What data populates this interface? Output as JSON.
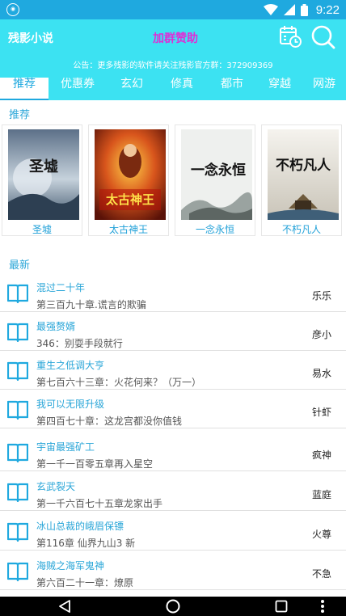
{
  "status_bar": {
    "time": "9:22",
    "icons": [
      "notification-icon",
      "wifi-icon",
      "signal-icon",
      "battery-icon"
    ]
  },
  "header": {
    "app_title": "残影小说",
    "join_label": "加群赞助",
    "notice": "公告：更多残影的软件请关注残影官方群：372909369",
    "icons": [
      "calendar-clock-icon",
      "search-icon"
    ]
  },
  "tabs": [
    "推荐",
    "优惠券",
    "玄幻",
    "修真",
    "都市",
    "穿越",
    "网游"
  ],
  "recommend": {
    "title": "推荐",
    "books": [
      {
        "title": "圣墟",
        "cover_text": "圣墟"
      },
      {
        "title": "太古神王",
        "cover_text": "太古神王"
      },
      {
        "title": "一念永恒",
        "cover_text": "一念永恒"
      },
      {
        "title": "不朽凡人",
        "cover_text": "不朽凡人"
      }
    ]
  },
  "latest": {
    "title": "最新",
    "items": [
      {
        "name": "混过二十年",
        "chapter": "第三百九十章.谎言的欺骗",
        "author": "乐乐"
      },
      {
        "name": "最强赘婿",
        "chapter": "346：别耍手段就行",
        "author": "彦小"
      },
      {
        "name": "重生之低调大亨",
        "chapter": "第七百六十三章：火花何来？（万一）",
        "author": "易水"
      },
      {
        "name": "我可以无限升级",
        "chapter": "第四百七十章：这龙宫都没你值钱",
        "author": "针虾"
      },
      {
        "name": "宇宙最强矿工",
        "chapter": "第一千一百零五章再入星空",
        "author": "疯神"
      },
      {
        "name": "玄武裂天",
        "chapter": "第一千六百七十五章龙家出手",
        "author": "蓝庭"
      },
      {
        "name": "冰山总裁的峨眉保镖",
        "chapter": "第116章 仙界九山3 新",
        "author": "火尊"
      },
      {
        "name": "海贼之海军鬼神",
        "chapter": "第六百二十一章：燎原",
        "author": "不急"
      }
    ]
  },
  "colors": {
    "header": "#3ce2f2",
    "status_bar": "#1fa9df",
    "accent": "#1fa9df",
    "join": "#e02cd6"
  },
  "nav_icons": [
    "back-icon",
    "home-icon",
    "recents-icon",
    "more-icon"
  ]
}
